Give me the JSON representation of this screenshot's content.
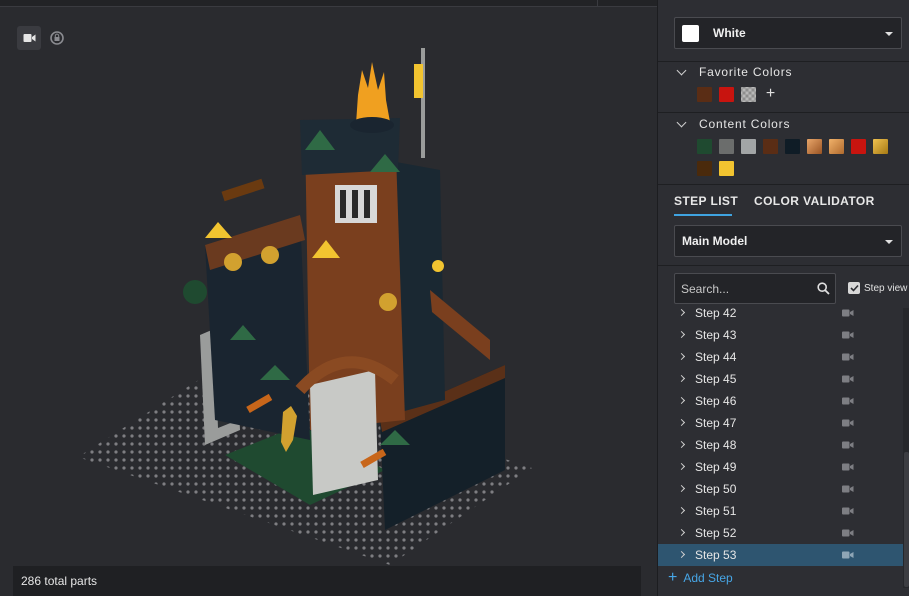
{
  "viewport": {
    "total_parts": "286 total parts",
    "tools": [
      {
        "name": "camera-icon",
        "active": true
      },
      {
        "name": "rotate-lock-icon",
        "active": false
      }
    ]
  },
  "panel": {
    "color_select": {
      "value": "White",
      "swatch": "#ffffff"
    },
    "favorite_colors": {
      "title": "Favorite Colors",
      "swatches": [
        "#5a2d15",
        "#c8140f",
        "checker"
      ]
    },
    "content_colors": {
      "title": "Content Colors",
      "swatches": [
        "#1f4a30",
        "#6b6d6c",
        "#a2a5a6",
        "#5a2d15",
        "#0f1c26",
        "#c07a3a",
        "#cf8a3e",
        "#c8140f",
        "#d2a12f",
        "#4a2a0c",
        "#f2c430"
      ]
    },
    "tabs": [
      {
        "label": "STEP LIST",
        "active": true
      },
      {
        "label": "COLOR VALIDATOR",
        "active": false
      }
    ],
    "model_select": {
      "value": "Main Model"
    },
    "search": {
      "placeholder": "Search..."
    },
    "step_view": {
      "label": "Step view",
      "checked": true
    },
    "steps": [
      "Step 42",
      "Step 43",
      "Step 44",
      "Step 45",
      "Step 46",
      "Step 47",
      "Step 48",
      "Step 49",
      "Step 50",
      "Step 51",
      "Step 52",
      "Step 53"
    ],
    "selected_step": "Step 53",
    "add_step_label": "Add Step"
  },
  "colors": {
    "accent": "#3fa3e0",
    "selected_row": "#2e5570",
    "link": "#47a6e6"
  }
}
